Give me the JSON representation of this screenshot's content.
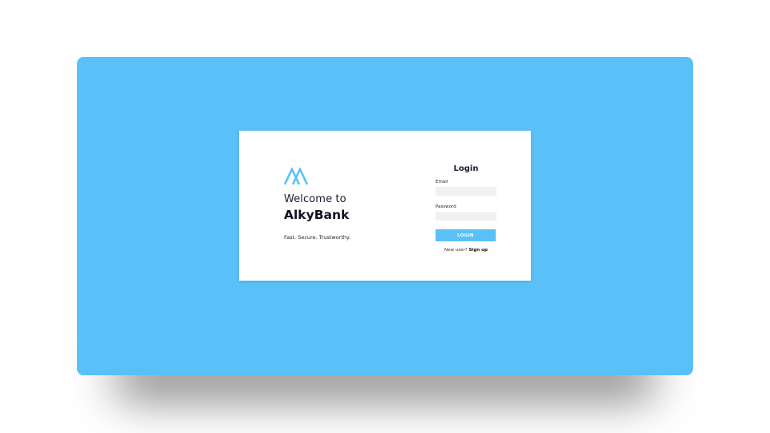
{
  "theme": {
    "accent": "#59c1f7",
    "background": "#ffffff",
    "card": "#ffffff"
  },
  "brand": {
    "logo_icon": "mountain-logo-icon",
    "welcome": "Welcome to",
    "name": "AlkyBank",
    "tagline": "Fast. Secure. Trustworthy."
  },
  "login": {
    "title": "Login",
    "email_label": "Email",
    "email_value": "",
    "password_label": "Password",
    "password_value": "",
    "button_label": "LOGIN",
    "signup_prompt": "New user?",
    "signup_link": "Sign up"
  }
}
